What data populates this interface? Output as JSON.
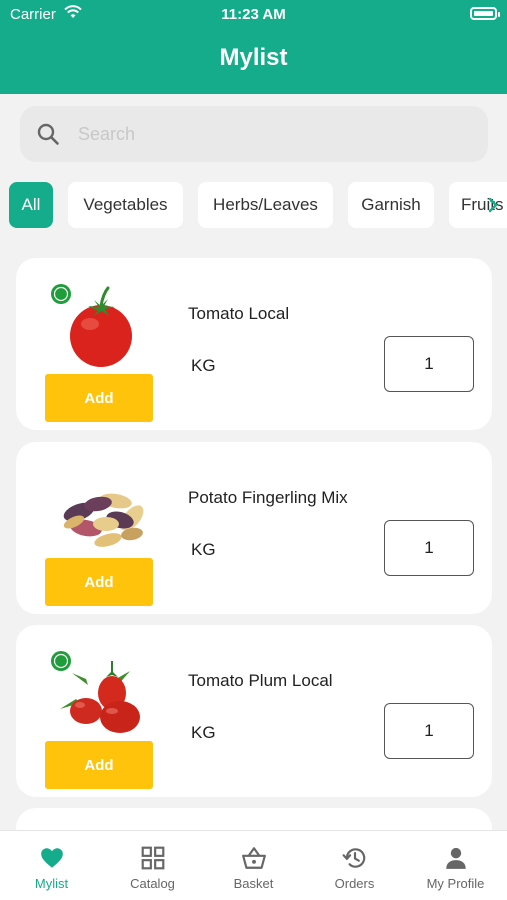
{
  "status_bar": {
    "carrier": "Carrier",
    "time": "11:23 AM"
  },
  "header": {
    "title": "Mylist"
  },
  "search": {
    "placeholder": "Search",
    "value": ""
  },
  "categories": [
    {
      "label": "All",
      "active": true
    },
    {
      "label": "Vegetables",
      "active": false
    },
    {
      "label": "Herbs/Leaves",
      "active": false
    },
    {
      "label": "Garnish",
      "active": false
    },
    {
      "label": "Fruits",
      "active": false
    }
  ],
  "products": [
    {
      "name": "Tomato Local",
      "unit": "KG",
      "quantity": "1",
      "add_label": "Add",
      "image_icon": "tomato-icon",
      "has_badge": true
    },
    {
      "name": "Potato Fingerling Mix",
      "unit": "KG",
      "quantity": "1",
      "add_label": "Add",
      "image_icon": "potato-icon",
      "has_badge": false
    },
    {
      "name": "Tomato Plum Local",
      "unit": "KG",
      "quantity": "1",
      "add_label": "Add",
      "image_icon": "tomato-plum-icon",
      "has_badge": true
    }
  ],
  "tabs": [
    {
      "label": "Mylist",
      "icon": "heart-icon",
      "active": true
    },
    {
      "label": "Catalog",
      "icon": "grid-icon",
      "active": false
    },
    {
      "label": "Basket",
      "icon": "basket-icon",
      "active": false
    },
    {
      "label": "Orders",
      "icon": "history-icon",
      "active": false
    },
    {
      "label": "My Profile",
      "icon": "person-icon",
      "active": false
    }
  ],
  "colors": {
    "brand": "#14ac8a",
    "add_button": "#fec30a",
    "background": "#f2f2f2"
  }
}
